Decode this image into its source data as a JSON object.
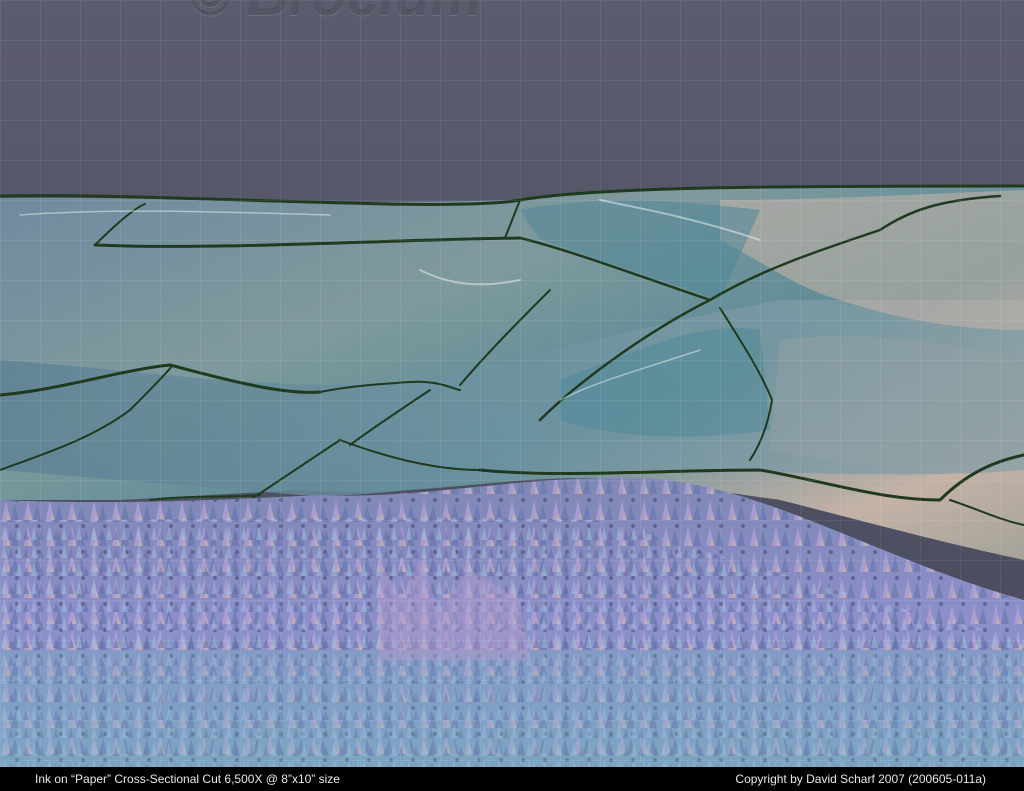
{
  "image": {
    "watermark": "© Brocium"
  },
  "caption": {
    "left": "Ink on “Paper” Cross-Sectional Cut   6,500X @ 8”x10” size",
    "right": "Copyright by David Scharf 2007   (200605-011a)"
  },
  "colors": {
    "background": "#4f5064",
    "ink_layer": "#7a8ea0",
    "paper_fibers": "#8f95c8",
    "crack": "#1f3a1e",
    "caption_bar": "#000000"
  }
}
